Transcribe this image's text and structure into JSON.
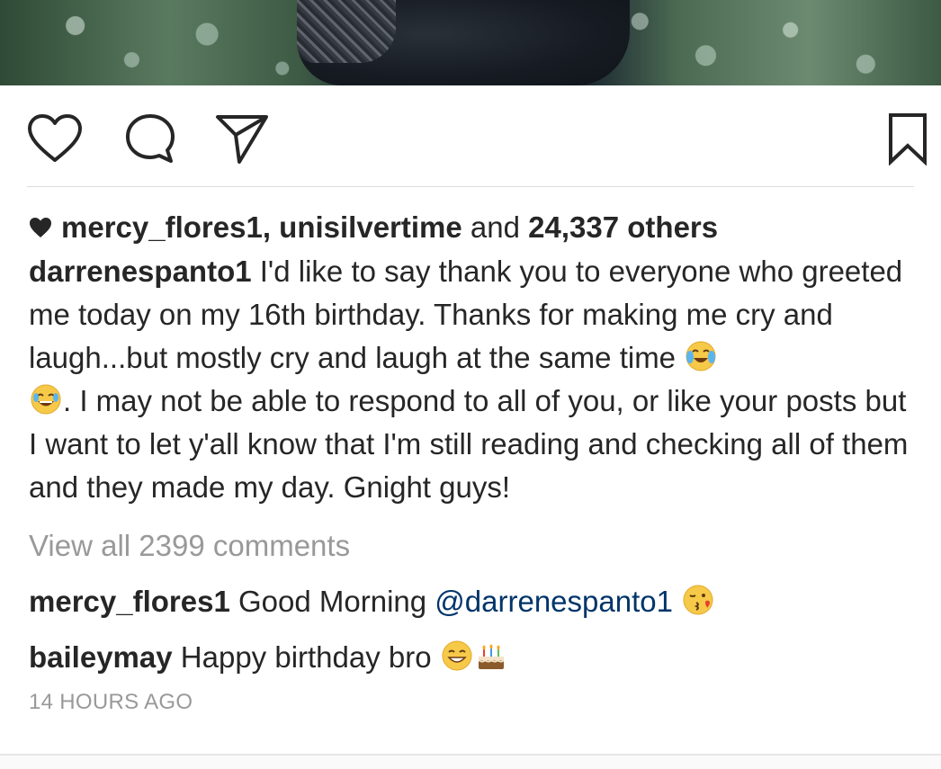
{
  "post": {
    "likes": {
      "user1": "mercy_flores1",
      "separator": ",",
      "user2": "unisilvertime",
      "and_text": "and",
      "others": "24,337 others"
    },
    "caption": {
      "username": "darrenespanto1",
      "text_part1": "I'd like to say thank you to everyone who greeted me today on my 16th birthday. Thanks for making me cry and laugh...but mostly cry and laugh at the same time",
      "text_part2": ". I may not be able to respond to all of you, or like your posts but I want to let y'all know that I'm still reading and checking all of them and they made my day. Gnight guys!"
    },
    "view_all_comments": "View all 2399 comments",
    "comments": [
      {
        "username": "mercy_flores1",
        "text": "Good Morning",
        "mention": "@darrenespanto1"
      },
      {
        "username": "baileymay",
        "text": "Happy birthday bro"
      }
    ],
    "timestamp": "14 HOURS AGO"
  },
  "icons": {
    "like": "heart-outline-icon",
    "comment": "comment-bubble-icon",
    "share": "paper-plane-icon",
    "save": "bookmark-icon",
    "emojis": [
      "crying-laughing-emoji",
      "face-with-tears-of-joy-emoji",
      "kissing-face-emoji",
      "grinning-face-emoji",
      "birthday-cake-emoji"
    ]
  },
  "colors": {
    "text": "#262626",
    "muted": "#999999",
    "mention": "#003569",
    "divider": "#dbdbdb"
  }
}
